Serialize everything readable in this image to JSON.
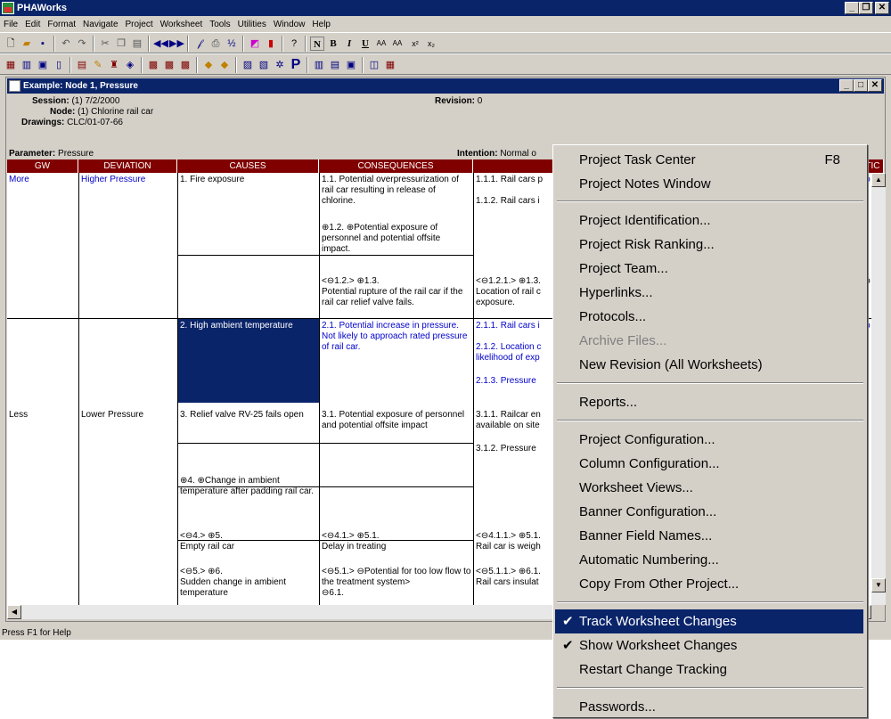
{
  "app": {
    "title": "PHAWorks",
    "status": "Press F1 for Help"
  },
  "menubar": [
    "File",
    "Edit",
    "Format",
    "Navigate",
    "Project",
    "Worksheet",
    "Tools",
    "Utilities",
    "Window",
    "Help"
  ],
  "window": {
    "title": "Example: Node 1, Pressure"
  },
  "banner": {
    "session_label": "Session:",
    "session": "(1) 7/2/2000",
    "node_label": "Node:",
    "node": "(1) Chlorine rail car",
    "drawings_label": "Drawings:",
    "drawings": "CLC/01-07-66",
    "parameter_label": "Parameter:",
    "parameter": "Pressure",
    "revision_label": "Revision:",
    "revision": "0",
    "intention_label": "Intention:",
    "intention": "Normal o"
  },
  "columns": [
    "GW",
    "DEVIATION",
    "CAUSES",
    "CONSEQUENCES",
    "S",
    "NDATIC"
  ],
  "cells": {
    "gw_more": "More",
    "dev_higher": "Higher Pressure",
    "cause1": "1. Fire exposure",
    "cons111": "1.1. Potential overpressurization of rail car resulting in release of chlorine.",
    "saf111": "1.1.1. Rail cars p",
    "saf112": "1.1.2. Rail cars i",
    "cons12": "⊕1.2. ⊕Potential exposure of personnel and potential offsite impact.",
    "cons13a": "<⊖1.2.> ⊕1.3.",
    "cons13b": "Potential rupture of the rail car if the rail car relief valve fails.",
    "saf121a": "<⊖1.2.1.> ⊕1.3.",
    "saf121b": "Location of rail c",
    "saf121c": "exposure.",
    "cause2": "2. High ambient temperature",
    "cons21": "2.1. Potential increase in pressure.  Not likely to approach rated pressure of rail car.",
    "saf211": "2.1.1. Rail cars i",
    "saf212a": "2.1.2. Location c",
    "saf212b": "likelihood of exp",
    "saf213": "2.1.3. Pressure",
    "gw_less": "Less",
    "dev_lower": "Lower Pressure",
    "cause3": "3. Relief valve RV-25  fails open",
    "cons31": "3.1. Potential exposure of personnel and potential offsite impact",
    "saf311a": "3.1.1. Railcar en",
    "saf311b": "available on site",
    "saf312": "3.1.2. Pressure",
    "cause4": "⊕4. ⊕Change in ambient temperature after padding rail car.",
    "cause5a": "<⊖4.> ⊕5.",
    "cause5b": "Empty rail car",
    "cons51a": "<⊖4.1.> ⊕5.1.",
    "cons51b": "Delay in treating",
    "saf511a": "<⊖4.1.1.> ⊕5.1.",
    "saf511b": "Rail car is weigh",
    "cause6a": "<⊖5.> ⊕6.",
    "cause6b": "Sudden change in ambient",
    "cause6c": "temperature",
    "cons61a": "<⊖5.1.> ⊖Potential for too low flow to the treatment system>",
    "cons61b": "⊖6.1.",
    "saf611a": "<⊖5.1.1.> ⊕6.1.",
    "saf611b": "Rail cars insulat",
    "rec1": "datio",
    "rec2": "datio",
    "rec3": "datio",
    "rec4a": "ctin",
    "rec4b": "cts a",
    "rec4c": "cal p",
    "rec5": "mm",
    "rec6": "mm"
  },
  "menu": {
    "items": [
      {
        "label": "Project Task Center",
        "shortcut": "F8"
      },
      {
        "label": "Project Notes Window"
      },
      {
        "label": "Project Identification..."
      },
      {
        "label": "Project Risk Ranking..."
      },
      {
        "label": "Project Team..."
      },
      {
        "label": "Hyperlinks..."
      },
      {
        "label": "Protocols..."
      },
      {
        "label": "Archive Files..."
      },
      {
        "label": "New Revision (All Worksheets)"
      },
      {
        "label": "Reports..."
      },
      {
        "label": "Project Configuration..."
      },
      {
        "label": "Column Configuration..."
      },
      {
        "label": "Worksheet Views..."
      },
      {
        "label": "Banner Configuration..."
      },
      {
        "label": "Banner Field Names..."
      },
      {
        "label": "Automatic Numbering..."
      },
      {
        "label": "Copy From Other Project..."
      },
      {
        "label": "Track Worksheet Changes",
        "check": "✔"
      },
      {
        "label": "Show Worksheet Changes",
        "check": "✔"
      },
      {
        "label": "Restart Change Tracking"
      },
      {
        "label": "Passwords..."
      }
    ]
  }
}
